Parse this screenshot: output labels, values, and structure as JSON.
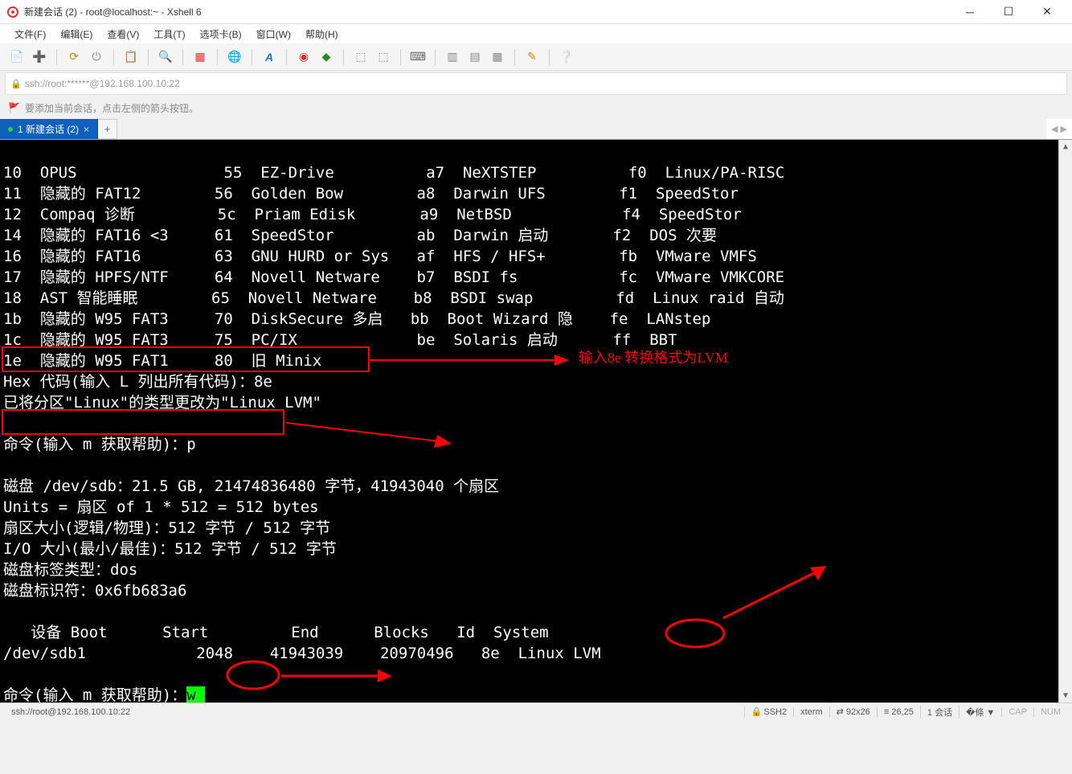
{
  "window": {
    "title": "新建会话 (2) - root@localhost:~ - Xshell 6"
  },
  "menu": {
    "file": "文件(F)",
    "edit": "编辑(E)",
    "view": "查看(V)",
    "tools": "工具(T)",
    "tab": "选项卡(B)",
    "window": "窗口(W)",
    "help": "帮助(H)"
  },
  "address": "ssh://root:******@192.168.100.10:22",
  "hint": "要添加当前会话，点击左侧的箭头按钮。",
  "tab": {
    "label": "1 新建会话 (2)"
  },
  "term_lines": [
    "10  OPUS                55  EZ-Drive          a7  NeXTSTEP          f0  Linux/PA-RISC",
    "11  隐藏的 FAT12        56  Golden Bow        a8  Darwin UFS        f1  SpeedStor",
    "12  Compaq 诊断         5c  Priam Edisk       a9  NetBSD            f4  SpeedStor",
    "14  隐藏的 FAT16 <3     61  SpeedStor         ab  Darwin 启动       f2  DOS 次要",
    "16  隐藏的 FAT16        63  GNU HURD or Sys   af  HFS / HFS+        fb  VMware VMFS",
    "17  隐藏的 HPFS/NTF     64  Novell Netware    b7  BSDI fs           fc  VMware VMKCORE",
    "18  AST 智能睡眠        65  Novell Netware    b8  BSDI swap         fd  Linux raid 自动",
    "1b  隐藏的 W95 FAT3     70  DiskSecure 多启   bb  Boot Wizard 隐    fe  LANstep",
    "1c  隐藏的 W95 FAT3     75  PC/IX             be  Solaris 启动      ff  BBT",
    "1e  隐藏的 W95 FAT1     80  旧 Minix",
    "Hex 代码(输入 L 列出所有代码)：8e",
    "已将分区\"Linux\"的类型更改为\"Linux LVM\"",
    "",
    "命令(输入 m 获取帮助)：p",
    "",
    "磁盘 /dev/sdb：21.5 GB, 21474836480 字节，41943040 个扇区",
    "Units = 扇区 of 1 * 512 = 512 bytes",
    "扇区大小(逻辑/物理)：512 字节 / 512 字节",
    "I/O 大小(最小/最佳)：512 字节 / 512 字节",
    "磁盘标签类型：dos",
    "磁盘标识符：0x6fb683a6",
    "",
    "   设备 Boot      Start         End      Blocks   Id  System",
    "/dev/sdb1            2048    41943039    20970496   8e  Linux LVM",
    "",
    "命令(输入 m 获取帮助)："
  ],
  "cursor_char": "w",
  "annotations": {
    "note": "输入8e 转换格式为LVM"
  },
  "status": {
    "conn": "ssh://root@192.168.100.10:22",
    "proto": "SSH2",
    "term": "xterm",
    "size": "92x26",
    "pos": "26,25",
    "sess": "1 会话",
    "caps": "CAP",
    "num": "NUM"
  }
}
